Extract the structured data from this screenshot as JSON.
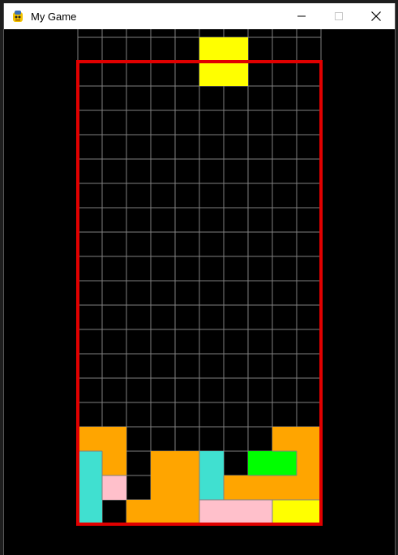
{
  "window": {
    "title": "My Game",
    "app_icon": "pygame-snake-icon",
    "controls": [
      "minimize-icon",
      "maximize-icon",
      "close-icon"
    ]
  },
  "colors": {
    "border": "#e00000",
    "grid": "#808080",
    "background": "#000000",
    "orange": "#ffa500",
    "yellow": "#ffff00",
    "cyan": "#40e0d0",
    "pink": "#ffc0cb",
    "green": "#00ff00"
  },
  "board": {
    "columns": 10,
    "visible_rows": 20,
    "falling_piece": {
      "color": "yellow",
      "cells": [
        [
          5,
          0
        ],
        [
          6,
          0
        ],
        [
          5,
          1
        ],
        [
          6,
          1
        ]
      ]
    },
    "locked_cells": [
      [
        0,
        16,
        "orange"
      ],
      [
        1,
        16,
        "orange"
      ],
      [
        8,
        16,
        "orange"
      ],
      [
        9,
        16,
        "orange"
      ],
      [
        0,
        17,
        "cyan"
      ],
      [
        1,
        17,
        "orange"
      ],
      [
        3,
        17,
        "orange"
      ],
      [
        4,
        17,
        "orange"
      ],
      [
        5,
        17,
        "cyan"
      ],
      [
        7,
        17,
        "green"
      ],
      [
        8,
        17,
        "green"
      ],
      [
        9,
        17,
        "orange"
      ],
      [
        0,
        18,
        "cyan"
      ],
      [
        1,
        18,
        "pink"
      ],
      [
        3,
        18,
        "orange"
      ],
      [
        4,
        18,
        "orange"
      ],
      [
        5,
        18,
        "cyan"
      ],
      [
        6,
        18,
        "orange"
      ],
      [
        7,
        18,
        "orange"
      ],
      [
        8,
        18,
        "orange"
      ],
      [
        9,
        18,
        "orange"
      ],
      [
        0,
        19,
        "cyan"
      ],
      [
        2,
        19,
        "orange"
      ],
      [
        3,
        19,
        "orange"
      ],
      [
        4,
        19,
        "orange"
      ],
      [
        5,
        19,
        "pink"
      ],
      [
        6,
        19,
        "pink"
      ],
      [
        7,
        19,
        "pink"
      ],
      [
        8,
        19,
        "yellow"
      ],
      [
        9,
        19,
        "yellow"
      ]
    ]
  }
}
